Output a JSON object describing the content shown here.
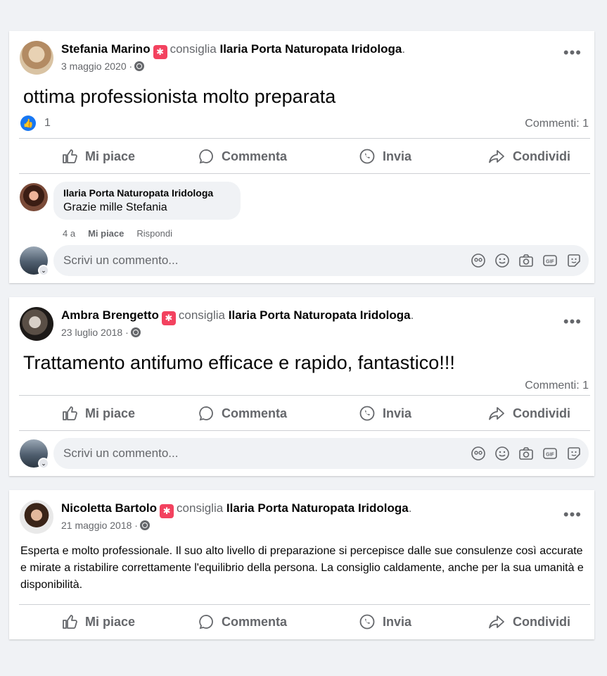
{
  "common": {
    "recommends": "consiglia",
    "page_name": "Ilaria Porta Naturopata Iridologa",
    "like_label": "Mi piace",
    "comment_label": "Commenta",
    "send_label": "Invia",
    "share_label": "Condividi",
    "write_placeholder": "Scrivi un commento...",
    "like_color": "#1877f2",
    "badge_color": "#f3425f"
  },
  "posts": [
    {
      "author": "Stefania Marino",
      "date": "3 maggio 2020",
      "text": "ottima professionista molto preparata",
      "likes": "1",
      "comments": "Commenti: 1",
      "comment": {
        "author": "Ilaria Porta Naturopata Iridologa",
        "text": "Grazie mille Stefania",
        "age": "4 a",
        "like": "Mi piace",
        "reply": "Rispondi"
      }
    },
    {
      "author": "Ambra Brengetto",
      "date": "23 luglio 2018",
      "text": "Trattamento antifumo efficace e rapido, fantastico!!!",
      "comments": "Commenti: 1"
    },
    {
      "author": "Nicoletta Bartolo",
      "date": "21 maggio 2018",
      "text": "Esperta e molto professionale. Il suo alto livello di preparazione si percepisce dalle sue  consulenze così accurate e mirate a ristabilire correttamente l'equilibrio della persona.  La consiglio caldamente,  anche per la sua  umanità e disponibilità."
    }
  ]
}
